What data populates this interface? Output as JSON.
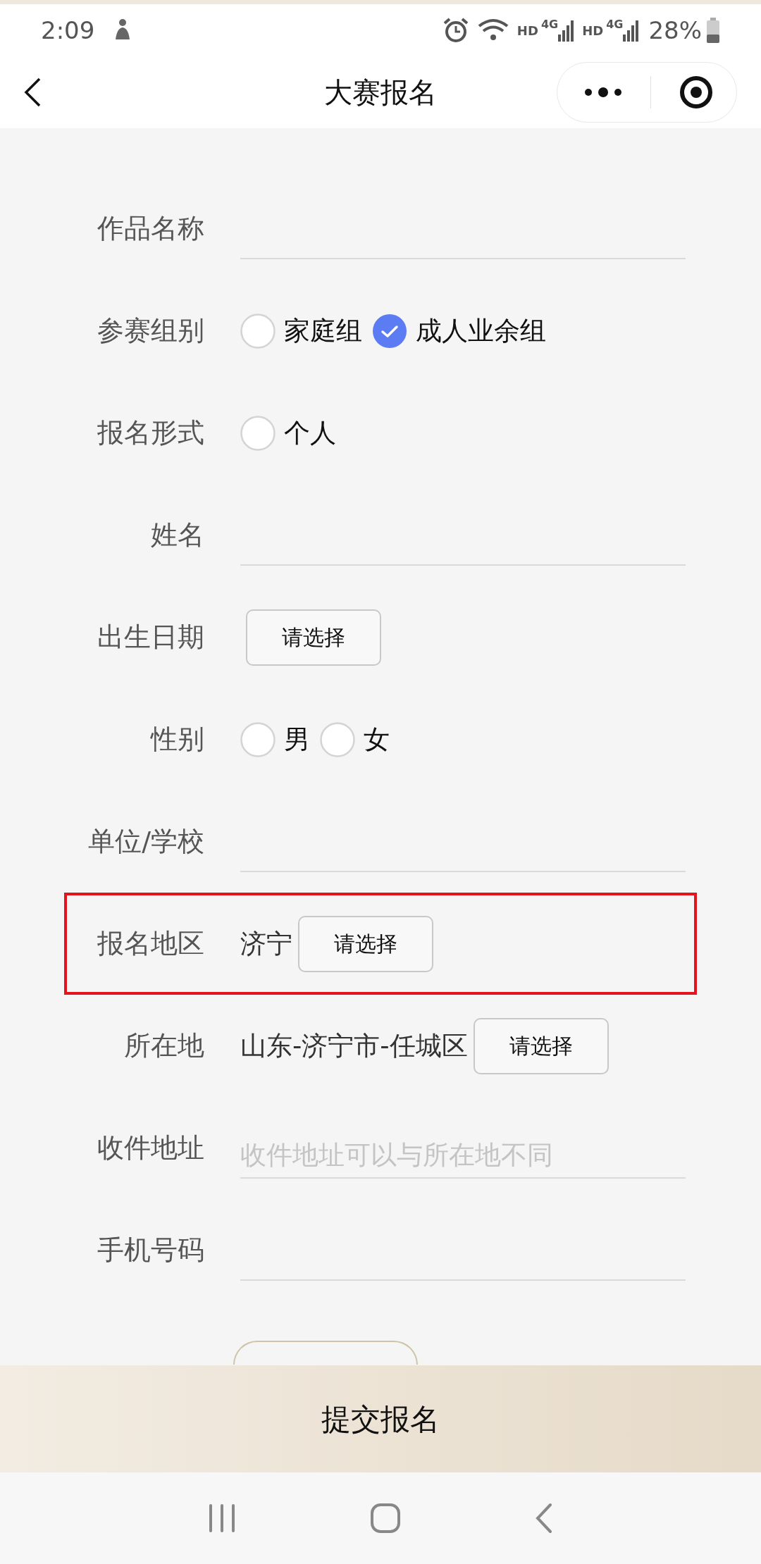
{
  "status_bar": {
    "time": "2:09",
    "networks": [
      {
        "label": "HD",
        "sub": "4G"
      },
      {
        "label": "HD",
        "sub": "4G"
      }
    ],
    "battery": "28%"
  },
  "nav_bar": {
    "title": "大赛报名"
  },
  "form": {
    "rows": [
      {
        "label": "作品名称",
        "kind": "input",
        "highlighted": false
      },
      {
        "label": "参赛组别",
        "kind": "radio",
        "highlighted": false,
        "options": [
          {
            "label": "家庭组",
            "selected": false
          },
          {
            "label": "成人业余组",
            "selected": true
          }
        ]
      },
      {
        "label": "报名形式",
        "kind": "radio",
        "highlighted": false,
        "options": [
          {
            "label": "个人",
            "selected": false
          }
        ]
      },
      {
        "label": "姓名",
        "kind": "input",
        "highlighted": false
      },
      {
        "label": "出生日期",
        "kind": "picker",
        "highlighted": false,
        "button": "请选择"
      },
      {
        "label": "性别",
        "kind": "radio",
        "highlighted": false,
        "options": [
          {
            "label": "男",
            "selected": false
          },
          {
            "label": "女",
            "selected": false
          }
        ]
      },
      {
        "label": "单位/学校",
        "kind": "input",
        "highlighted": false
      },
      {
        "label": "报名地区",
        "kind": "picker",
        "highlighted": true,
        "value": "济宁",
        "button": "请选择"
      },
      {
        "label": "所在地",
        "kind": "picker",
        "highlighted": false,
        "value": "山东-济宁市-任城区",
        "button": "请选择"
      },
      {
        "label": "收件地址",
        "kind": "input",
        "highlighted": false,
        "placeholder": "收件地址可以与所在地不同"
      },
      {
        "label": "手机号码",
        "kind": "input",
        "highlighted": false
      },
      {
        "kind": "file",
        "highlighted": false
      }
    ]
  },
  "submit_button": "提交报名"
}
